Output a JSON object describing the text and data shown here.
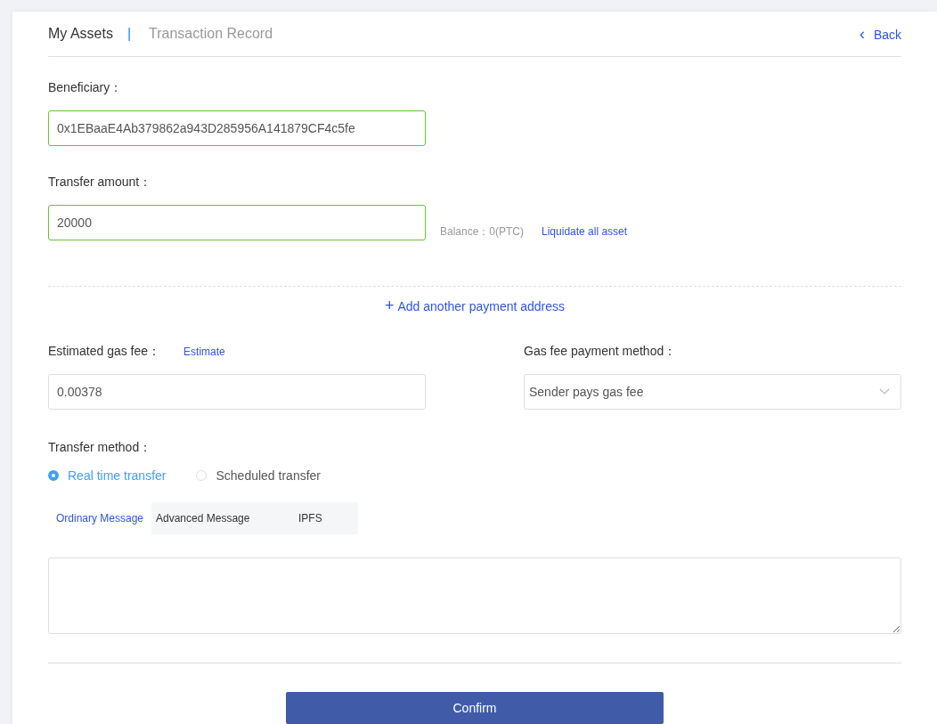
{
  "header": {
    "tabs": [
      {
        "label": "My Assets",
        "selected": true
      },
      {
        "label": "Transaction Record",
        "selected": false
      }
    ],
    "separator": "|",
    "back": {
      "icon": "‹",
      "label": "Back"
    }
  },
  "beneficiary": {
    "label": "Beneficiary：",
    "value": "0x1EBaaE4Ab379862a943D285956A141879CF4c5fe",
    "valid": true
  },
  "amount": {
    "label": "Transfer amount：",
    "value": "20000",
    "valid": true,
    "balance": "Balance：0(PTC)",
    "liquidate": "Liquidate all asset"
  },
  "add_address": {
    "icon": "+",
    "label": "Add another payment address"
  },
  "gas_fee": {
    "label": "Estimated gas fee：",
    "estimate": "Estimate",
    "value": "0.00378"
  },
  "gas_payment": {
    "label": "Gas fee payment method：",
    "value": "Sender pays gas fee"
  },
  "transfer_method": {
    "label": "Transfer method：",
    "options": [
      {
        "label": "Real time transfer",
        "selected": true
      },
      {
        "label": "Scheduled transfer",
        "selected": false
      }
    ]
  },
  "message_tabs": [
    {
      "label": "Ordinary Message",
      "selected": true
    },
    {
      "label": "Advanced Message",
      "selected": false
    },
    {
      "label": "IPFS",
      "selected": false
    }
  ],
  "confirm": "Confirm"
}
